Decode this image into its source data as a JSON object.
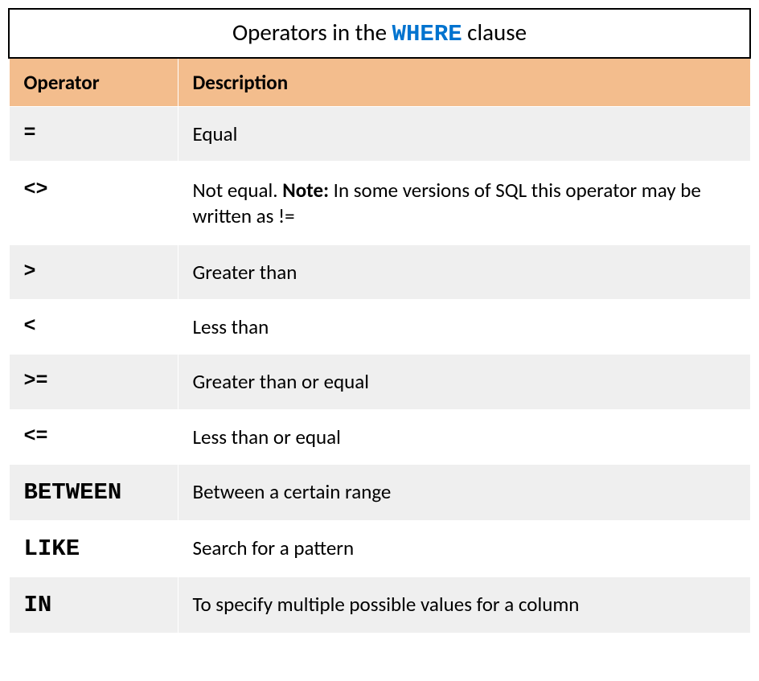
{
  "title": {
    "prefix": "Operators in the ",
    "keyword": "WHERE",
    "suffix": " clause"
  },
  "headers": {
    "operator": "Operator",
    "description": "Description"
  },
  "rows": {
    "equal": {
      "op": "=",
      "desc": "Equal"
    },
    "notequal": {
      "op": "<>",
      "desc_pre": "Not equal. ",
      "note_label": "Note:",
      "desc_post": " In some versions of SQL this operator may be written as !="
    },
    "gt": {
      "op": ">",
      "desc": "Greater than"
    },
    "lt": {
      "op": "<",
      "desc": "Less than"
    },
    "gte": {
      "op": ">=",
      "desc": "Greater than or equal"
    },
    "lte": {
      "op": "<=",
      "desc": "Less than or equal"
    },
    "between": {
      "op": "BETWEEN",
      "desc": "Between a certain range"
    },
    "like": {
      "op": "LIKE",
      "desc": "Search for a pattern"
    },
    "in": {
      "op": "IN",
      "desc": "To specify multiple possible values for a column"
    }
  }
}
